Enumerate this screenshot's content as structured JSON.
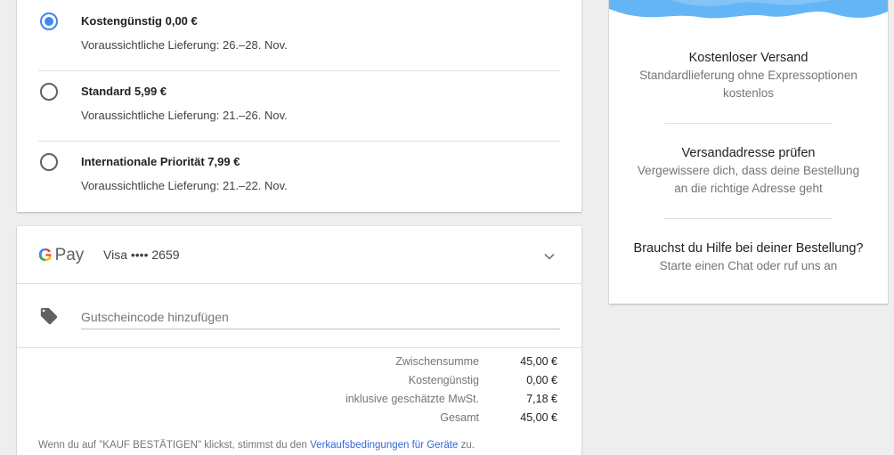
{
  "shipping": {
    "options": [
      {
        "title": "Kostengünstig 0,00 €",
        "eta": "Voraussichtliche Lieferung: 26.–28. Nov.",
        "selected": true
      },
      {
        "title": "Standard 5,99 €",
        "eta": "Voraussichtliche Lieferung: 21.–26. Nov.",
        "selected": false
      },
      {
        "title": "Internationale Priorität 7,99 €",
        "eta": "Voraussichtliche Lieferung: 21.–22. Nov.",
        "selected": false
      }
    ]
  },
  "payment": {
    "brand_g": "G",
    "brand_pay": "Pay",
    "card": "Visa •••• 2659",
    "coupon_placeholder": "Gutscheincode hinzufügen"
  },
  "totals": [
    {
      "label": "Zwischensumme",
      "value": "45,00 €"
    },
    {
      "label": "Kostengünstig",
      "value": "0,00 €"
    },
    {
      "label": "inklusive geschätzte MwSt.",
      "value": "7,18 €"
    },
    {
      "label": "Gesamt",
      "value": "45,00 €"
    }
  ],
  "terms": {
    "prefix": "Wenn du auf \"KAUF BESTÄTIGEN\" klickst, stimmst du den ",
    "link": "Verkaufsbedingungen für Geräte",
    "suffix": " zu."
  },
  "info": {
    "blocks": [
      {
        "heading": "Kostenloser Versand",
        "lines": [
          "Standardlieferung ohne Expressoptionen",
          "kostenlos"
        ]
      },
      {
        "heading": "Versandadresse prüfen",
        "lines": [
          "Vergewissere dich, dass deine Bestellung",
          "an die richtige Adresse geht"
        ]
      },
      {
        "heading": "Brauchst du Hilfe bei deiner Bestellung?",
        "lines": [
          "Starte einen Chat oder ruf uns an"
        ]
      }
    ]
  },
  "colors": {
    "accent": "#4285f4",
    "link": "#3367d6",
    "banner": "#64b5f6"
  },
  "icons": {
    "coupon": "tag-icon",
    "expand": "chevron-down-icon",
    "radio": "radio-button"
  }
}
